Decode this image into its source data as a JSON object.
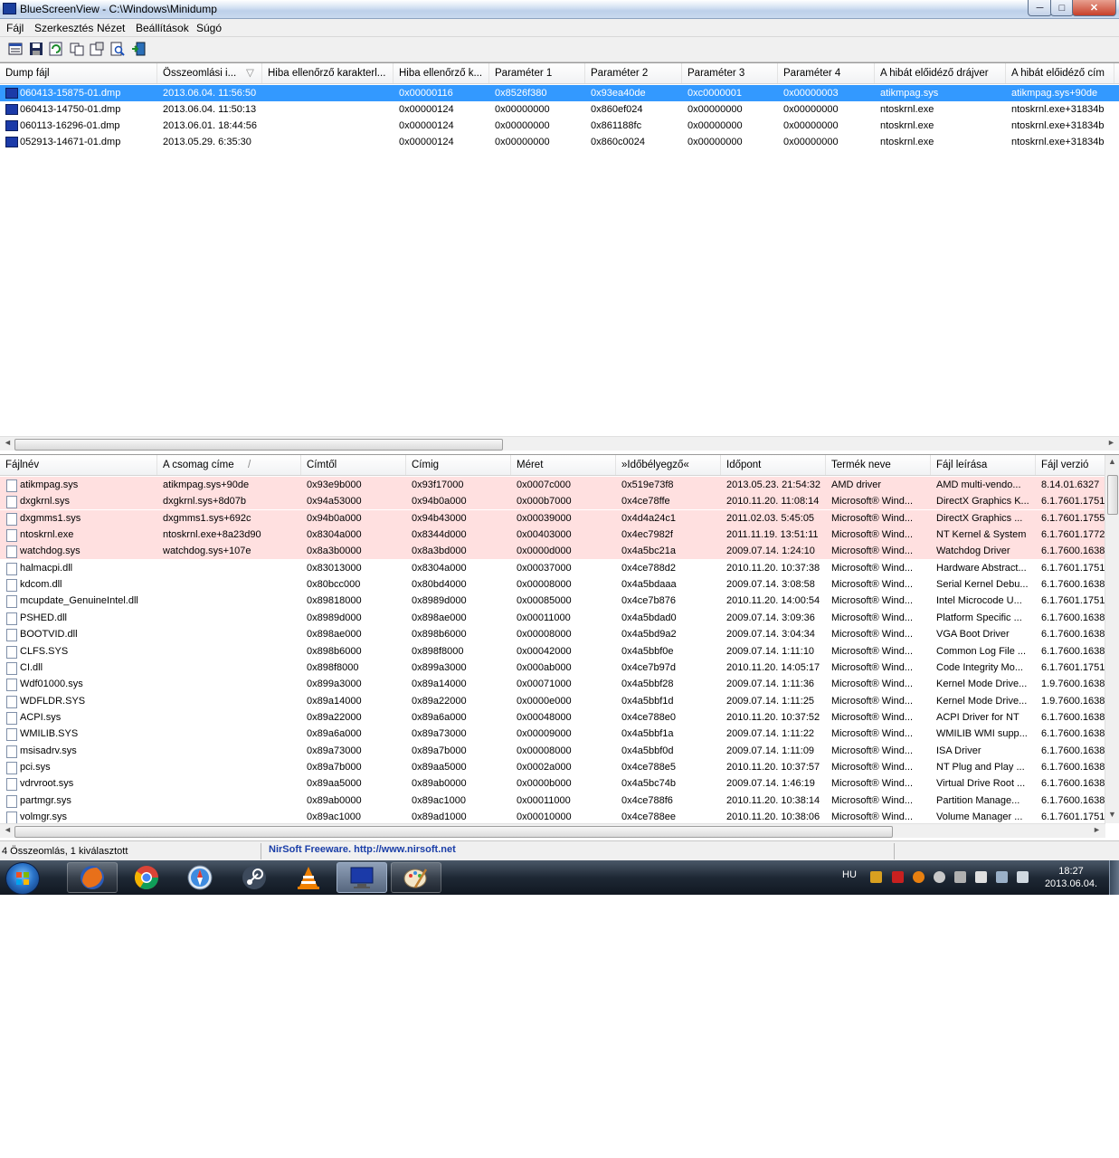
{
  "window": {
    "title": "BlueScreenView  -  C:\\Windows\\Minidump",
    "min": "─",
    "max": "□",
    "close": "✕"
  },
  "menu": [
    "Fájl",
    "Szerkesztés",
    "Nézet",
    "Beállítások",
    "Súgó"
  ],
  "toolbar_icons": [
    "properties-icon",
    "save-icon",
    "refresh-icon",
    "copy-icon",
    "options-icon",
    "find-icon",
    "exit-icon"
  ],
  "top_table": {
    "columns": [
      "Dump fájl",
      "Összeomlási i...",
      "Hiba ellenőrző karakterl...",
      "Hiba ellenőrző k...",
      "Paraméter 1",
      "Paraméter 2",
      "Paraméter 3",
      "Paraméter 4",
      "A hibát előidéző drájver",
      "A hibát előidéző cím"
    ],
    "sort_marker": "▽",
    "rows": [
      [
        "060413-15875-01.dmp",
        "2013.06.04. 11:56:50",
        "",
        "0x00000116",
        "0x8526f380",
        "0x93ea40de",
        "0xc0000001",
        "0x00000003",
        "atikmpag.sys",
        "atikmpag.sys+90de"
      ],
      [
        "060413-14750-01.dmp",
        "2013.06.04. 11:50:13",
        "",
        "0x00000124",
        "0x00000000",
        "0x860ef024",
        "0x00000000",
        "0x00000000",
        "ntoskrnl.exe",
        "ntoskrnl.exe+31834b"
      ],
      [
        "060113-16296-01.dmp",
        "2013.06.01. 18:44:56",
        "",
        "0x00000124",
        "0x00000000",
        "0x861188fc",
        "0x00000000",
        "0x00000000",
        "ntoskrnl.exe",
        "ntoskrnl.exe+31834b"
      ],
      [
        "052913-14671-01.dmp",
        "2013.05.29. 6:35:30",
        "",
        "0x00000124",
        "0x00000000",
        "0x860c0024",
        "0x00000000",
        "0x00000000",
        "ntoskrnl.exe",
        "ntoskrnl.exe+31834b"
      ]
    ],
    "selected_row": 0
  },
  "bottom_table": {
    "columns": [
      "Fájlnév",
      "A csomag címe",
      "Címtől",
      "Címig",
      "Méret",
      "»Időbélyegző«",
      "Időpont",
      "Termék neve",
      "Fájl leírása",
      "Fájl verzió"
    ],
    "sort_marker": "/",
    "highlighted_rows": 5,
    "rows": [
      [
        "atikmpag.sys",
        "atikmpag.sys+90de",
        "0x93e9b000",
        "0x93f17000",
        "0x0007c000",
        "0x519e73f8",
        "2013.05.23. 21:54:32",
        "AMD driver",
        "AMD multi-vendo...",
        "8.14.01.6327"
      ],
      [
        "dxgkrnl.sys",
        "dxgkrnl.sys+8d07b",
        "0x94a53000",
        "0x94b0a000",
        "0x000b7000",
        "0x4ce78ffe",
        "2010.11.20. 11:08:14",
        "Microsoft® Wind...",
        "DirectX Graphics K...",
        "6.1.7601.1751"
      ],
      [
        "dxgmms1.sys",
        "dxgmms1.sys+692c",
        "0x94b0a000",
        "0x94b43000",
        "0x00039000",
        "0x4d4a24c1",
        "2011.02.03. 5:45:05",
        "Microsoft® Wind...",
        "DirectX Graphics ...",
        "6.1.7601.1755"
      ],
      [
        "ntoskrnl.exe",
        "ntoskrnl.exe+8a23d90",
        "0x8304a000",
        "0x8344d000",
        "0x00403000",
        "0x4ec7982f",
        "2011.11.19. 13:51:11",
        "Microsoft® Wind...",
        "NT Kernel & System",
        "6.1.7601.1772"
      ],
      [
        "watchdog.sys",
        "watchdog.sys+107e",
        "0x8a3b0000",
        "0x8a3bd000",
        "0x0000d000",
        "0x4a5bc21a",
        "2009.07.14. 1:24:10",
        "Microsoft® Wind...",
        "Watchdog Driver",
        "6.1.7600.1638"
      ],
      [
        "halmacpi.dll",
        "",
        "0x83013000",
        "0x8304a000",
        "0x00037000",
        "0x4ce788d2",
        "2010.11.20. 10:37:38",
        "Microsoft® Wind...",
        "Hardware Abstract...",
        "6.1.7601.1751"
      ],
      [
        "kdcom.dll",
        "",
        "0x80bcc000",
        "0x80bd4000",
        "0x00008000",
        "0x4a5bdaaa",
        "2009.07.14. 3:08:58",
        "Microsoft® Wind...",
        "Serial Kernel Debu...",
        "6.1.7600.1638"
      ],
      [
        "mcupdate_GenuineIntel.dll",
        "",
        "0x89818000",
        "0x8989d000",
        "0x00085000",
        "0x4ce7b876",
        "2010.11.20. 14:00:54",
        "Microsoft® Wind...",
        "Intel Microcode U...",
        "6.1.7601.1751"
      ],
      [
        "PSHED.dll",
        "",
        "0x8989d000",
        "0x898ae000",
        "0x00011000",
        "0x4a5bdad0",
        "2009.07.14. 3:09:36",
        "Microsoft® Wind...",
        "Platform Specific ...",
        "6.1.7600.1638"
      ],
      [
        "BOOTVID.dll",
        "",
        "0x898ae000",
        "0x898b6000",
        "0x00008000",
        "0x4a5bd9a2",
        "2009.07.14. 3:04:34",
        "Microsoft® Wind...",
        "VGA Boot Driver",
        "6.1.7600.1638"
      ],
      [
        "CLFS.SYS",
        "",
        "0x898b6000",
        "0x898f8000",
        "0x00042000",
        "0x4a5bbf0e",
        "2009.07.14. 1:11:10",
        "Microsoft® Wind...",
        "Common Log File ...",
        "6.1.7600.1638"
      ],
      [
        "CI.dll",
        "",
        "0x898f8000",
        "0x899a3000",
        "0x000ab000",
        "0x4ce7b97d",
        "2010.11.20. 14:05:17",
        "Microsoft® Wind...",
        "Code Integrity Mo...",
        "6.1.7601.1751"
      ],
      [
        "Wdf01000.sys",
        "",
        "0x899a3000",
        "0x89a14000",
        "0x00071000",
        "0x4a5bbf28",
        "2009.07.14. 1:11:36",
        "Microsoft® Wind...",
        "Kernel Mode Drive...",
        "1.9.7600.1638"
      ],
      [
        "WDFLDR.SYS",
        "",
        "0x89a14000",
        "0x89a22000",
        "0x0000e000",
        "0x4a5bbf1d",
        "2009.07.14. 1:11:25",
        "Microsoft® Wind...",
        "Kernel Mode Drive...",
        "1.9.7600.1638"
      ],
      [
        "ACPI.sys",
        "",
        "0x89a22000",
        "0x89a6a000",
        "0x00048000",
        "0x4ce788e0",
        "2010.11.20. 10:37:52",
        "Microsoft® Wind...",
        "ACPI Driver for NT",
        "6.1.7600.1638"
      ],
      [
        "WMILIB.SYS",
        "",
        "0x89a6a000",
        "0x89a73000",
        "0x00009000",
        "0x4a5bbf1a",
        "2009.07.14. 1:11:22",
        "Microsoft® Wind...",
        "WMILIB WMI supp...",
        "6.1.7600.1638"
      ],
      [
        "msisadrv.sys",
        "",
        "0x89a73000",
        "0x89a7b000",
        "0x00008000",
        "0x4a5bbf0d",
        "2009.07.14. 1:11:09",
        "Microsoft® Wind...",
        "ISA Driver",
        "6.1.7600.1638"
      ],
      [
        "pci.sys",
        "",
        "0x89a7b000",
        "0x89aa5000",
        "0x0002a000",
        "0x4ce788e5",
        "2010.11.20. 10:37:57",
        "Microsoft® Wind...",
        "NT Plug and Play ...",
        "6.1.7600.1638"
      ],
      [
        "vdrvroot.sys",
        "",
        "0x89aa5000",
        "0x89ab0000",
        "0x0000b000",
        "0x4a5bc74b",
        "2009.07.14. 1:46:19",
        "Microsoft® Wind...",
        "Virtual Drive Root ...",
        "6.1.7600.1638"
      ],
      [
        "partmgr.sys",
        "",
        "0x89ab0000",
        "0x89ac1000",
        "0x00011000",
        "0x4ce788f6",
        "2010.11.20. 10:38:14",
        "Microsoft® Wind...",
        "Partition Manage...",
        "6.1.7600.1638"
      ],
      [
        "volmgr.sys",
        "",
        "0x89ac1000",
        "0x89ad1000",
        "0x00010000",
        "0x4ce788ee",
        "2010.11.20. 10:38:06",
        "Microsoft® Wind...",
        "Volume Manager ...",
        "6.1.7601.1751"
      ]
    ]
  },
  "status": {
    "count": "4 Összeomlás, 1 kiválasztott",
    "credit": "NirSoft Freeware.  http://www.nirsoft.net"
  },
  "taskbar": {
    "apps": [
      "firefox-icon",
      "chrome-icon",
      "safari-icon",
      "steam-icon",
      "vlc-icon",
      "bluescreenview-icon",
      "paint-icon"
    ],
    "active_app": "bluescreenview-icon",
    "language": "HU",
    "time": "18:27",
    "date": "2013.06.04."
  },
  "colors": {
    "selection": "#3399ff",
    "highlight_row": "#ffe0e0",
    "credit_link": "#1a3ea8"
  }
}
